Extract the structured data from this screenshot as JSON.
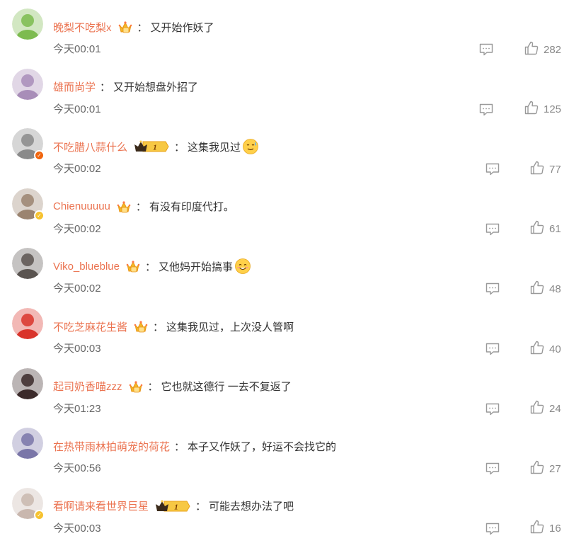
{
  "colors": {
    "username": "#eb7350",
    "text": "#333333",
    "time": "#666666",
    "icon": "#999999"
  },
  "comments": [
    {
      "username": "晚梨不吃梨x",
      "badge": "crown-icon",
      "text": "又开始作妖了",
      "emoji": "",
      "time": "今天00:01",
      "likes": "282",
      "avatar_color": "#7dbb4f",
      "verify": ""
    },
    {
      "username": "雄而尚学",
      "badge": "",
      "text": "又开始想盘外招了",
      "emoji": "",
      "time": "今天00:01",
      "likes": "125",
      "avatar_color": "#a88db8",
      "verify": ""
    },
    {
      "username": "不吃腊八蒜什么",
      "badge": "vip-level-1-icon",
      "vip_level": "1",
      "text": "这集我见过",
      "emoji": "sweat-smile-emoji",
      "time": "今天00:02",
      "likes": "77",
      "avatar_color": "#8a8a8a",
      "verify": "orange"
    },
    {
      "username": "Chienuuuuu",
      "badge": "crown-icon",
      "text": "有没有印度代打。",
      "emoji": "",
      "time": "今天00:02",
      "likes": "61",
      "avatar_color": "#9b8470",
      "verify": "gold"
    },
    {
      "username": "Viko_blueblue",
      "badge": "crown-icon",
      "text": "又他妈开始搞事",
      "emoji": "smile-emoji",
      "time": "今天00:02",
      "likes": "48",
      "avatar_color": "#5a5450",
      "verify": ""
    },
    {
      "username": "不吃芝麻花生酱",
      "badge": "crown-icon",
      "text": "这集我见过，上次没人管啊",
      "emoji": "",
      "time": "今天00:03",
      "likes": "40",
      "avatar_color": "#d9342b",
      "verify": ""
    },
    {
      "username": "起司奶香喵zzz",
      "badge": "crown-icon",
      "text": "它也就这德行 一去不复返了",
      "emoji": "",
      "time": "今天01:23",
      "likes": "24",
      "avatar_color": "#3b2a2a",
      "verify": ""
    },
    {
      "username": "在热带雨林拍萌宠的荷花",
      "badge": "",
      "text": "本子又作妖了，好运不会找它的",
      "emoji": "",
      "time": "今天00:56",
      "likes": "27",
      "avatar_color": "#7a76a8",
      "verify": ""
    },
    {
      "username": "看啊请来看世界巨星",
      "badge": "vip-level-1-icon",
      "vip_level": "1",
      "text": "可能去想办法了吧",
      "emoji": "",
      "time": "今天00:03",
      "likes": "16",
      "avatar_color": "#c9b7ae",
      "verify": "gold"
    }
  ],
  "labels": {
    "colon": "："
  }
}
